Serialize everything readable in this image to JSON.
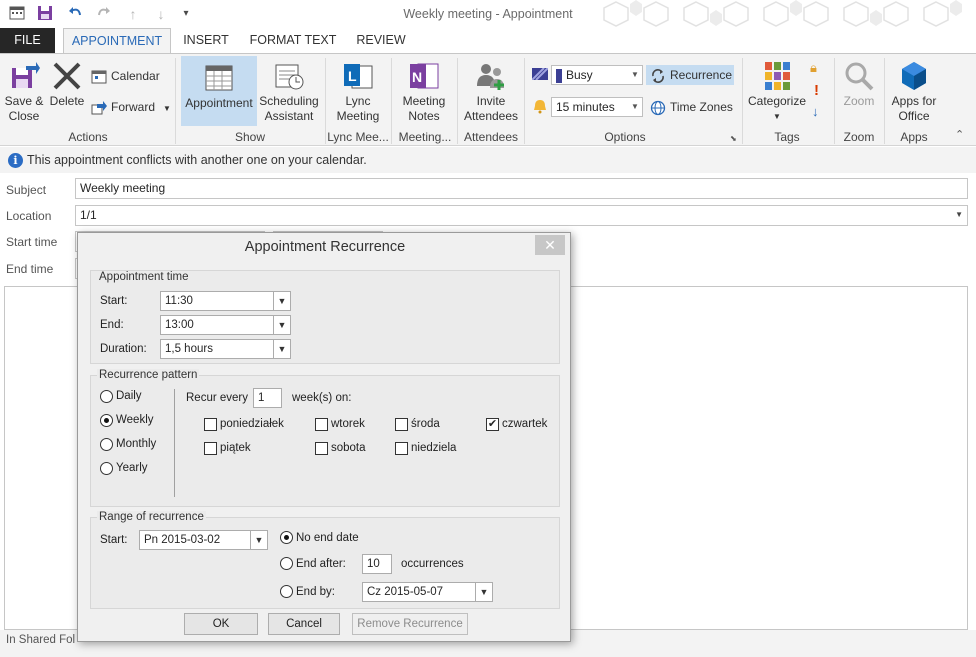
{
  "window": {
    "title": "Weekly meeting - Appointment"
  },
  "quick_access": {
    "icons": [
      "calendar-app-icon",
      "save-icon",
      "undo-icon",
      "redo-icon",
      "up-icon",
      "down-icon",
      "customize-icon"
    ]
  },
  "tabs": [
    {
      "label": "FILE"
    },
    {
      "label": "APPOINTMENT"
    },
    {
      "label": "INSERT"
    },
    {
      "label": "FORMAT TEXT"
    },
    {
      "label": "REVIEW"
    }
  ],
  "ribbon": {
    "actions": {
      "save_close": "Save &\nClose",
      "save_line1": "Save &",
      "save_line2": "Close",
      "delete": "Delete",
      "calendar": "Calendar",
      "forward": "Forward",
      "group": "Actions"
    },
    "show": {
      "appointment": "Appointment",
      "scheduling_line1": "Scheduling",
      "scheduling_line2": "Assistant",
      "group": "Show"
    },
    "lync": {
      "line1": "Lync",
      "line2": "Meeting",
      "group": "Lync Mee..."
    },
    "meeting_notes": {
      "line1": "Meeting",
      "line2": "Notes",
      "group": "Meeting..."
    },
    "attendees": {
      "line1": "Invite",
      "line2": "Attendees",
      "group": "Attendees"
    },
    "options": {
      "show_as": "Busy",
      "reminder": "15 minutes",
      "recurrence": "Recurrence",
      "time_zones": "Time Zones",
      "group": "Options"
    },
    "tags": {
      "categorize": "Categorize",
      "group": "Tags"
    },
    "zoom": {
      "label": "Zoom",
      "group": "Zoom"
    },
    "apps": {
      "line1": "Apps for",
      "line2": "Office",
      "group": "Apps"
    }
  },
  "infobar": {
    "message": "This appointment conflicts with another one on your calendar."
  },
  "form": {
    "subject_label": "Subject",
    "subject_value": "Weekly meeting",
    "location_label": "Location",
    "location_value": "1/1",
    "start_label": "Start time",
    "end_label": "End time"
  },
  "status": {
    "text": "In Shared Fol"
  },
  "dialog": {
    "title": "Appointment Recurrence",
    "appointment_time": {
      "heading": "Appointment time",
      "start_label": "Start:",
      "start_value": "11:30",
      "end_label": "End:",
      "end_value": "13:00",
      "duration_label": "Duration:",
      "duration_value": "1,5 hours"
    },
    "pattern": {
      "heading": "Recurrence pattern",
      "options": [
        {
          "label": "Daily",
          "selected": false
        },
        {
          "label": "Weekly",
          "selected": true
        },
        {
          "label": "Monthly",
          "selected": false
        },
        {
          "label": "Yearly",
          "selected": false
        }
      ],
      "recur_every_label": "Recur every",
      "recur_every_value": "1",
      "weeks_on_label": "week(s) on:",
      "days": [
        {
          "label": "poniedziałek",
          "checked": false
        },
        {
          "label": "wtorek",
          "checked": false
        },
        {
          "label": "środa",
          "checked": false
        },
        {
          "label": "czwartek",
          "checked": true
        },
        {
          "label": "piątek",
          "checked": false
        },
        {
          "label": "sobota",
          "checked": false
        },
        {
          "label": "niedziela",
          "checked": false
        }
      ]
    },
    "range": {
      "heading": "Range of recurrence",
      "start_label": "Start:",
      "start_value": "Pn 2015-03-02",
      "no_end_label": "No end date",
      "end_after_label": "End after:",
      "end_after_value": "10",
      "occurrences_label": "occurrences",
      "end_by_label": "End by:",
      "end_by_value": "Cz 2015-05-07",
      "selected": "no_end"
    },
    "buttons": {
      "ok": "OK",
      "cancel": "Cancel",
      "remove": "Remove Recurrence"
    }
  },
  "colors": {
    "accent": "#2a6ab7",
    "selected_button": "#c5dcf1",
    "file_tab": "#262626"
  }
}
